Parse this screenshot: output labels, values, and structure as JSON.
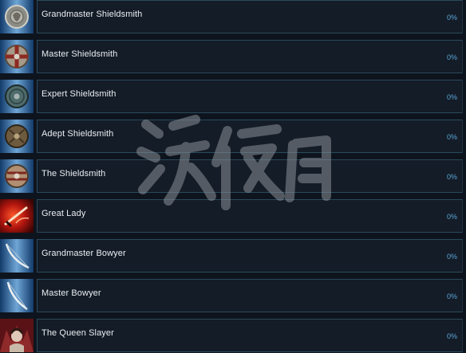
{
  "achievements": [
    {
      "title": "Grandmaster Shieldsmith",
      "progress": "0%",
      "icon": "lion-crest-shield-icon",
      "theme": "shield"
    },
    {
      "title": "Master Shieldsmith",
      "progress": "0%",
      "icon": "red-cross-round-shield-icon",
      "theme": "shield"
    },
    {
      "title": "Expert Shieldsmith",
      "progress": "0%",
      "icon": "steel-round-shield-icon",
      "theme": "shield"
    },
    {
      "title": "Adept Shieldsmith",
      "progress": "0%",
      "icon": "wooden-round-shield-icon",
      "theme": "shield"
    },
    {
      "title": "The Shieldsmith",
      "progress": "0%",
      "icon": "banded-round-shield-icon",
      "theme": "shield"
    },
    {
      "title": "Great Lady",
      "progress": "0%",
      "icon": "flaming-sword-icon",
      "theme": "fire"
    },
    {
      "title": "Grandmaster Bowyer",
      "progress": "0%",
      "icon": "longbow-icon",
      "theme": "bow"
    },
    {
      "title": "Master Bowyer",
      "progress": "0%",
      "icon": "bow-icon",
      "theme": "bow"
    },
    {
      "title": "The Queen Slayer",
      "progress": "0%",
      "icon": "queen-portrait-icon",
      "theme": "queen"
    }
  ],
  "colors": {
    "background": "#0e141d",
    "panel": "#141c27",
    "panel_border": "#2a4a5c",
    "title_text": "#e9eef2",
    "progress_text": "#5aa6d8",
    "watermark": "#8a9098"
  }
}
